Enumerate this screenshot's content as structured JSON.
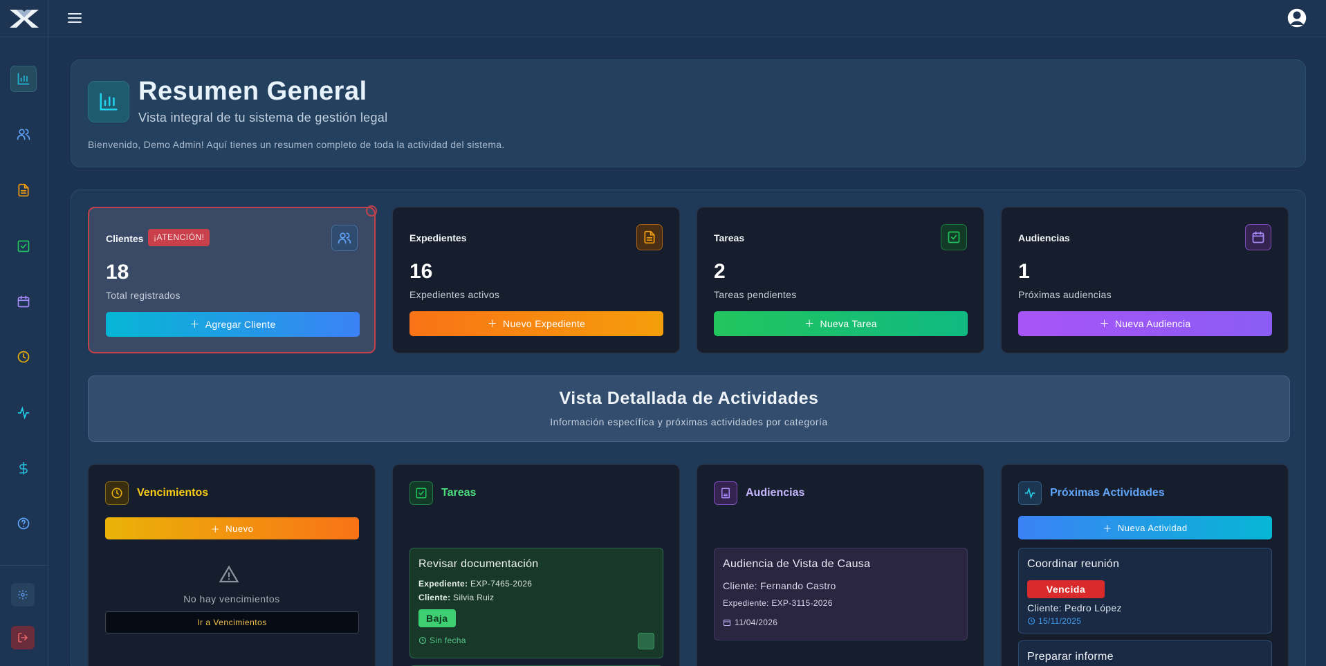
{
  "app": {
    "logo": "logo-x-icon",
    "accent": "#22d3ee"
  },
  "sidebar": {
    "items": [
      {
        "icon": "bar-chart-icon",
        "active": true,
        "color": "#22b7d4"
      },
      {
        "icon": "users-icon",
        "color": "#60a5fa"
      },
      {
        "icon": "document-icon",
        "color": "#f59e0b"
      },
      {
        "icon": "check-square-icon",
        "color": "#22c55e"
      },
      {
        "icon": "calendar-icon",
        "color": "#a78bfa"
      },
      {
        "icon": "clock-icon",
        "color": "#eab308"
      },
      {
        "icon": "activity-icon",
        "color": "#22d3ee"
      },
      {
        "icon": "dollar-icon",
        "color": "#22b7d4"
      },
      {
        "icon": "help-icon",
        "color": "#60a5fa"
      }
    ],
    "bottom": [
      {
        "icon": "settings-icon"
      },
      {
        "icon": "logout-icon"
      }
    ]
  },
  "topbar": {
    "menu_icon": "hamburger-icon",
    "user_icon": "user-circle-icon"
  },
  "header": {
    "title": "Resumen General",
    "subtitle": "Vista integral de tu sistema de gestión legal",
    "welcome": "Bienvenido, Demo Admin! Aquí tienes un resumen completo de toda la actividad del sistema."
  },
  "stats": [
    {
      "title": "Clientes",
      "badge": "¡ATENCIÓN!",
      "value": "18",
      "label": "Total registrados",
      "button": "Agregar Cliente",
      "icon": "users-icon",
      "colors": [
        "#06b6d4",
        "#3b82f6"
      ]
    },
    {
      "title": "Expedientes",
      "value": "16",
      "label": "Expedientes activos",
      "button": "Nuevo Expediente",
      "icon": "document-icon",
      "colors": [
        "#f97316",
        "#f59e0b"
      ]
    },
    {
      "title": "Tareas",
      "value": "2",
      "label": "Tareas pendientes",
      "button": "Nueva Tarea",
      "icon": "check-square-icon",
      "colors": [
        "#22c55e",
        "#10b981"
      ]
    },
    {
      "title": "Audiencias",
      "value": "1",
      "label": "Próximas audiencias",
      "button": "Nueva Audiencia",
      "icon": "calendar-icon",
      "colors": [
        "#a855f7",
        "#8b5cf6"
      ]
    }
  ],
  "vista": {
    "title": "Vista Detallada de Actividades",
    "subtitle": "Información específica y próximas actividades por categoría"
  },
  "vencimientos": {
    "title": "Vencimientos",
    "button": "Nuevo",
    "empty": "No hay vencimientos",
    "link": "Ir a Vencimientos"
  },
  "tareas": {
    "title": "Tareas",
    "items": [
      {
        "title": "Revisar documentación",
        "exp_label": "Expediente:",
        "exp": "EXP-7465-2026",
        "cli_label": "Cliente:",
        "cli": "Silvia Ruiz",
        "priority": "Baja",
        "date": "Sin fecha"
      }
    ]
  },
  "audiencias": {
    "title": "Audiencias",
    "items": [
      {
        "title": "Audiencia de Vista de Causa",
        "client": "Cliente: Fernando Castro",
        "exp": "Expediente: EXP-3115-2026",
        "date": "11/04/2026"
      }
    ]
  },
  "actividades": {
    "title": "Próximas Actividades",
    "button": "Nueva Actividad",
    "items": [
      {
        "title": "Coordinar reunión",
        "status": "Vencida",
        "client": "Cliente: Pedro López",
        "date": "15/11/2025"
      },
      {
        "title": "Preparar informe"
      }
    ]
  }
}
